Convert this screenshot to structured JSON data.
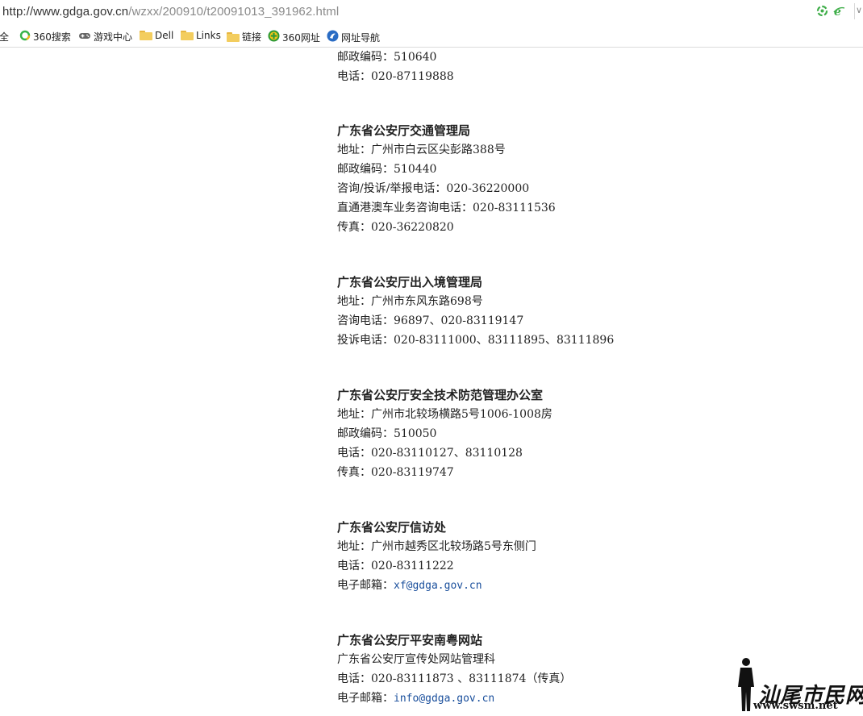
{
  "browser": {
    "url_host": "http://www.gdga.gov.cn",
    "url_path": "/wzxx/200910/t20091013_391962.html",
    "addr_icons": [
      "refresh-icon",
      "ie-compat-icon"
    ],
    "bookmarks": [
      {
        "label": "大全",
        "icon": "partial"
      },
      {
        "label": "360搜索",
        "icon": "search-360-icon"
      },
      {
        "label": "游戏中心",
        "icon": "gamepad-icon"
      },
      {
        "label": "Dell",
        "icon": "folder-icon"
      },
      {
        "label": "Links",
        "icon": "folder-icon"
      },
      {
        "label": "链接",
        "icon": "folder-icon"
      },
      {
        "label": "360网址",
        "icon": "plus-360-icon"
      },
      {
        "label": "网址导航",
        "icon": "nav-icon"
      }
    ]
  },
  "content": {
    "lines": [
      {
        "text": "邮政编码：510640",
        "type": "text"
      },
      {
        "text": "电话：020-87119888",
        "type": "text"
      },
      {
        "text": "广东省公安厅交通管理局",
        "type": "title"
      },
      {
        "text": "地址：广州市白云区尖彭路388号",
        "type": "text"
      },
      {
        "text": "邮政编码：510440",
        "type": "text"
      },
      {
        "text": "咨询/投诉/举报电话：020-36220000",
        "type": "text"
      },
      {
        "text": "直通港澳车业务咨询电话：020-83111536",
        "type": "text"
      },
      {
        "text": "传真：020-36220820",
        "type": "text"
      },
      {
        "text": "广东省公安厅出入境管理局",
        "type": "title"
      },
      {
        "text": "地址：广州市东风东路698号",
        "type": "text"
      },
      {
        "text": "咨询电话：96897、020-83119147",
        "type": "text"
      },
      {
        "text": "投诉电话：020-83111000、83111895、83111896",
        "type": "text"
      },
      {
        "text": "广东省公安厅安全技术防范管理办公室",
        "type": "title"
      },
      {
        "text": "地址：广州市北较场横路5号1006-1008房",
        "type": "text"
      },
      {
        "text": "邮政编码：510050",
        "type": "text"
      },
      {
        "text": "电话：020-83110127、83110128",
        "type": "text"
      },
      {
        "text": "传真：020-83119747",
        "type": "text"
      },
      {
        "text": "广东省公安厅信访处",
        "type": "title"
      },
      {
        "text": "地址：广州市越秀区北较场路5号东侧门",
        "type": "text"
      },
      {
        "text": "电话：020-83111222",
        "type": "text"
      },
      {
        "text": "电子邮箱：",
        "type": "email",
        "email": "xf@gdga.gov.cn"
      },
      {
        "text": "广东省公安厅平安南粤网站",
        "type": "title"
      },
      {
        "text": "广东省公安厅宣传处网站管理科",
        "type": "text"
      },
      {
        "text": "电话：020-83111873 、83111874（传真）",
        "type": "text"
      },
      {
        "text": "电子邮箱：",
        "type": "email",
        "email": "info@gdga.gov.cn"
      }
    ]
  },
  "watermark": {
    "name": "汕尾市民网",
    "url": "www.swsm.net"
  }
}
